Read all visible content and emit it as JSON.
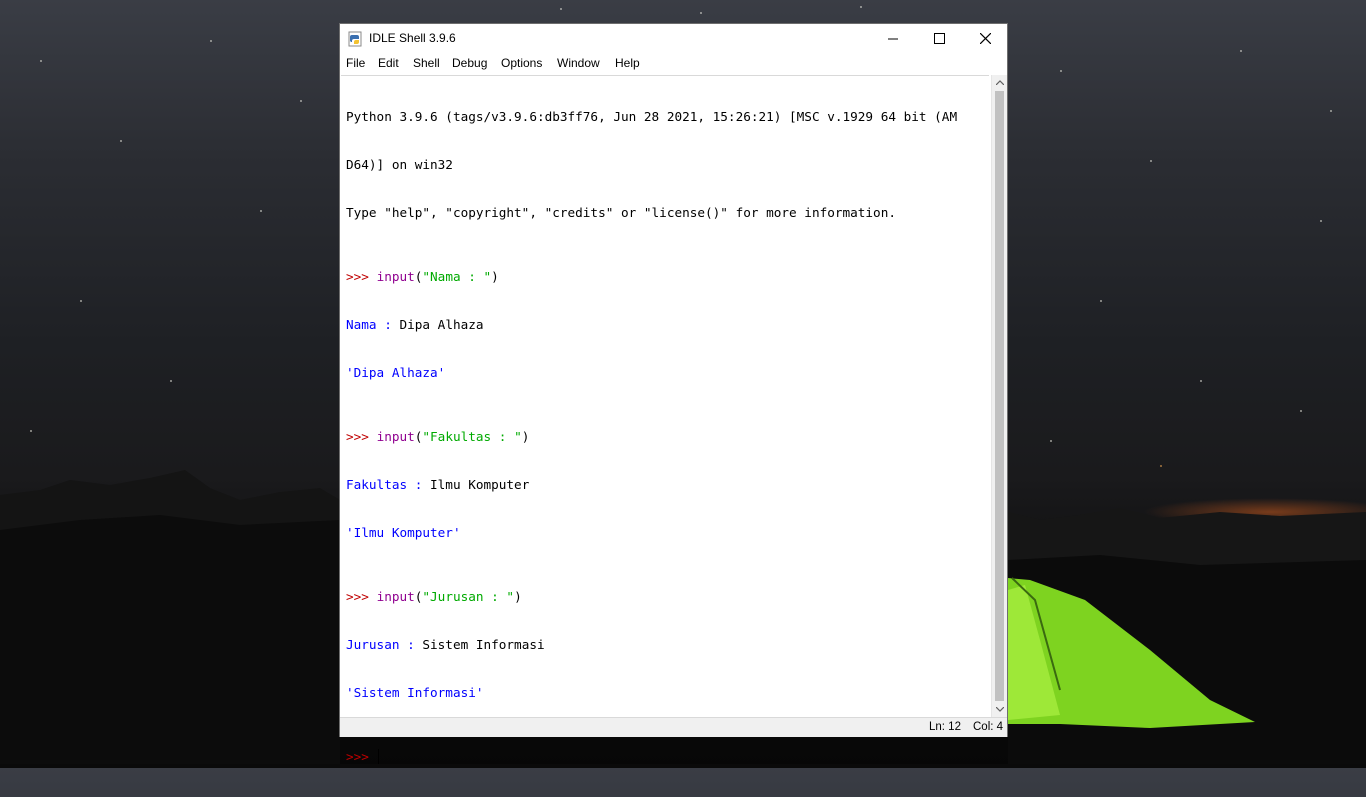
{
  "window": {
    "title": "IDLE Shell 3.9.6"
  },
  "menu": [
    "File",
    "Edit",
    "Shell",
    "Debug",
    "Options",
    "Window",
    "Help"
  ],
  "shell": {
    "banner_line1": "Python 3.9.6 (tags/v3.9.6:db3ff76, Jun 28 2021, 15:26:21) [MSC v.1929 64 bit (AM",
    "banner_line2": "D64)] on win32",
    "banner_line3": "Type \"help\", \"copyright\", \"credits\" or \"license()\" for more information.",
    "prompt": ">>> ",
    "entries": [
      {
        "func": "input",
        "open": "(",
        "arg": "\"Nama : \"",
        "close": ")",
        "prompt_label": "Nama : ",
        "user_input": "Dipa Alhaza",
        "result": "'Dipa Alhaza'"
      },
      {
        "func": "input",
        "open": "(",
        "arg": "\"Fakultas : \"",
        "close": ")",
        "prompt_label": "Fakultas : ",
        "user_input": "Ilmu Komputer",
        "result": "'Ilmu Komputer'"
      },
      {
        "func": "input",
        "open": "(",
        "arg": "\"Jurusan : \"",
        "close": ")",
        "prompt_label": "Jurusan : ",
        "user_input": "Sistem Informasi",
        "result": "'Sistem Informasi'"
      }
    ]
  },
  "status": {
    "ln": "Ln: 12",
    "col": "Col: 4"
  },
  "colors": {
    "prompt": "#c00000",
    "builtin": "#900090",
    "string": "#00aa00",
    "output": "#0000ff"
  },
  "icons": [
    "python-icon",
    "minimize-icon",
    "maximize-icon",
    "close-icon",
    "scroll-up-arrow-icon",
    "scroll-down-arrow-icon"
  ]
}
